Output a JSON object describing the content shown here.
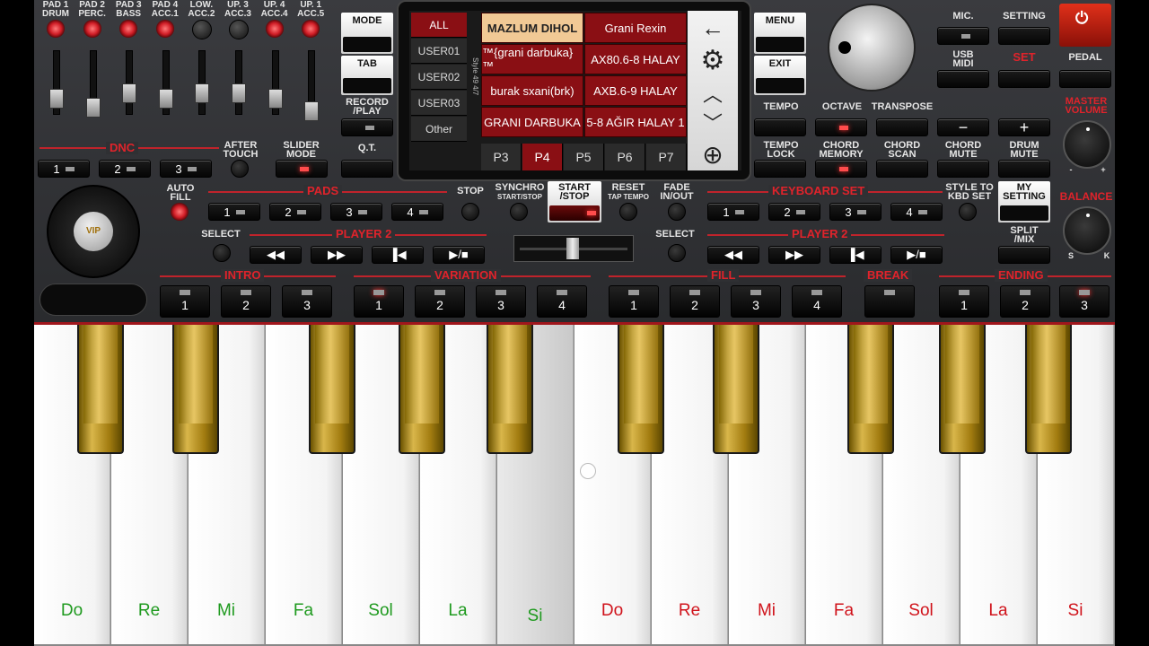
{
  "top_labels": [
    "PAD 1\nDRUM",
    "PAD 2\nPERC.",
    "PAD 3\nBASS",
    "PAD 4\nACC.1",
    "LOW.\nACC.2",
    "UP. 3\nACC.3",
    "UP. 4\nACC.4",
    "UP. 1\nACC.5"
  ],
  "left": {
    "dnc": "DNC",
    "after_touch": "AFTER\nTOUCH",
    "slider_mode": "SLIDER\nMODE",
    "dnc_buttons": [
      "1",
      "2",
      "3"
    ],
    "auto_fill": "AUTO\nFILL",
    "select": "SELECT",
    "logo": "VIP"
  },
  "mode_col": {
    "mode": "MODE",
    "tab": "TAB",
    "record_play": "RECORD\n/PLAY",
    "qt": "Q.T."
  },
  "screen": {
    "categories": [
      "ALL",
      "USER01",
      "USER02",
      "USER03",
      "Other"
    ],
    "style_side": "Style 49 4/7",
    "styles": [
      "MAZLUM DIHOL",
      "Grani Rexin",
      "™{grani darbuka}™",
      "AX80.6-8 HALAY",
      "burak sxani(brk)",
      "AXB.6-9 HALAY",
      "GRANI DARBUKA",
      "5-8 AĞIR HALAY 1"
    ],
    "pages": [
      "P3",
      "P4",
      "P5",
      "P6",
      "P7"
    ],
    "nav_icons": [
      "back-arrow-icon",
      "gear-icon",
      "chevron-up-icon",
      "chevron-down-icon",
      "add-circle-icon"
    ]
  },
  "right": {
    "menu": "MENU",
    "exit": "EXIT",
    "mic": "MIC.",
    "setting": "SETTING",
    "usb_midi": "USB\nMIDI",
    "set": "SET",
    "pedal": "PEDAL",
    "tempo": "TEMPO",
    "octave": "OCTAVE",
    "transpose": "TRANSPOSE",
    "minus": "−",
    "plus": "+",
    "tempo_lock": "TEMPO\nLOCK",
    "chord_memory": "CHORD\nMEMORY",
    "chord_scan": "CHORD\nSCAN",
    "chord_mute": "CHORD\nMUTE",
    "drum_mute": "DRUM\nMUTE",
    "master_volume": "MASTER\nVOLUME",
    "balance": "BALANCE",
    "vol_min": "-",
    "vol_max": "+",
    "bal_s": "S",
    "bal_k": "K",
    "style_to_kbd": "STYLE TO\nKBD SET",
    "my_setting": "MY\nSETTING",
    "split_mix": "SPLIT\n/MIX"
  },
  "mid": {
    "pads": "PADS",
    "pad_buttons": [
      "1",
      "2",
      "3",
      "4"
    ],
    "stop": "STOP",
    "synchro": "SYNCHRO",
    "synchro_sub": "START/STOP",
    "start_stop": "START\n/STOP",
    "reset": "RESET",
    "reset_sub": "TAP TEMPO",
    "fade": "FADE\nIN/OUT",
    "keyboard_set": "KEYBOARD SET",
    "kbd_buttons": [
      "1",
      "2",
      "3",
      "4"
    ],
    "player2": "PLAYER 2",
    "select": "SELECT",
    "transport": [
      "◀◀",
      "▶▶",
      "▐◀",
      "▶/■"
    ]
  },
  "sections": {
    "intro": "INTRO",
    "variation": "VARIATION",
    "fill": "FILL",
    "break": "BREAK",
    "ending": "ENDING",
    "intro_btns": [
      "1",
      "2",
      "3"
    ],
    "var_btns": [
      "1",
      "2",
      "3",
      "4"
    ],
    "fill_btns": [
      "1",
      "2",
      "3",
      "4"
    ],
    "ending_btns": [
      "1",
      "2",
      "3"
    ]
  },
  "keys": {
    "white": [
      "Do",
      "Re",
      "Mi",
      "Fa",
      "Sol",
      "La",
      "Si",
      "Do",
      "Re",
      "Mi",
      "Fa",
      "Sol",
      "La",
      "Si"
    ],
    "white_colors": [
      "#1f9a1f",
      "#1f9a1f",
      "#1f9a1f",
      "#1f9a1f",
      "#1f9a1f",
      "#1f9a1f",
      "#1f9a1f",
      "#d0131b",
      "#d0131b",
      "#d0131b",
      "#d0131b",
      "#d0131b",
      "#d0131b",
      "#d0131b"
    ]
  },
  "colors": {
    "accent": "#e0232b",
    "selected_style": "#f1c995",
    "screen_red": "#8a0f14",
    "power": "#c81d12"
  }
}
